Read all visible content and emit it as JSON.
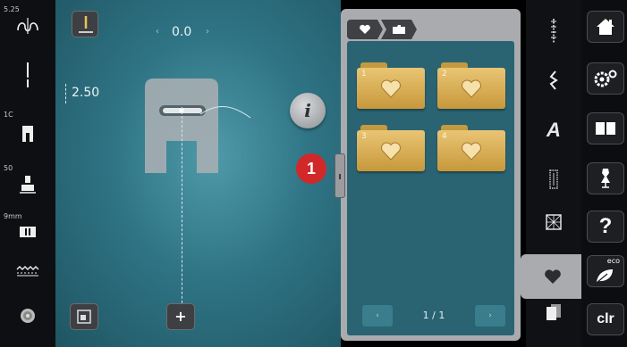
{
  "left_status": {
    "stitch_width_label": "5.25",
    "needle_label": "1C",
    "foot_label": "50",
    "needle_size_label": "9mm"
  },
  "main": {
    "needle_position_value": "0.0",
    "stitch_length_value": "2.50",
    "info_label": "i",
    "callout_number": "1",
    "add_button_label": "+"
  },
  "panel": {
    "breadcrumb": [
      "heart-icon",
      "folder-icon"
    ],
    "folders": [
      {
        "number": "1"
      },
      {
        "number": "2"
      },
      {
        "number": "3"
      },
      {
        "number": "4"
      }
    ],
    "pager_text": "1 / 1",
    "pager_prev": "‹",
    "pager_next": "›"
  },
  "categories": {
    "icons": [
      "practical-stitches-icon",
      "decorative-stitches-icon",
      "alphabets-icon",
      "buttonholes-icon",
      "quilt-stitches-icon",
      "personal-program-icon",
      "memory-icon"
    ],
    "text_letter": "A",
    "active": "personal-program-icon"
  },
  "rightbar": {
    "help_label": "?",
    "eco_label": "eco",
    "clr_label": "clr"
  }
}
